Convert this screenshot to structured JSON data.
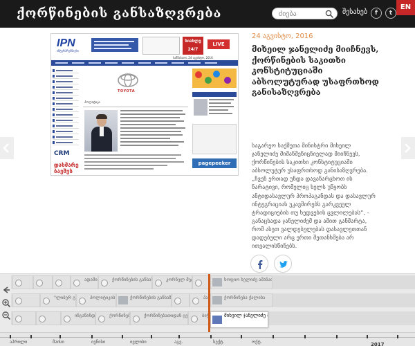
{
  "header": {
    "site_title": "ქორწინების განსაზღვრება",
    "search_placeholder": "ძიება",
    "about_label": "შესახებ",
    "facebook_label": "f",
    "twitter_label": "t",
    "lang_label": "EN"
  },
  "preview": {
    "logo": "IPN",
    "logo_sub": "ინტერპრესნიუსი",
    "ad_badge": "სიახლე 24/7",
    "live_label": "LIVE",
    "date_text": "სამშაბათი, 24 აგვისტო, 2016",
    "brand_text": "TOYOTA",
    "tab_label": "პოლიტიკა",
    "crm_label": "CRM",
    "bottom_logo": "დახმარე ბავშვს",
    "pagepeeker_label": "pagepeeker"
  },
  "article": {
    "date": "24 აგვისტო, 2016",
    "title": "მიხეილ ჯანელიძე მიიჩნევს, ქორწინების საკითხი კონსტიტუციაში აბსოლუტურად უსაფრთხოდ განისაზღვრება",
    "body": "საგარეო საქმეთა მინისტრი მიხეილ ჯანელიძე მიმანშენიცნიელად მიიჩნევს, ქორწინების საკითხი კონსტიტუციაში აბსოლუტურ უსაფრთხოდ განისაზღვრება. „ჩვენ ერთად უნდა დავანარცხოთ ის ნარატივი, რომელიც ხელს უწყობს ანტიდასავლურ პროპაგანდას და დასავლურ ინტეგრაციას უკავშირებს გარკვეულ ტრადიციების თუ ხედვების ცვლილებას“, - განაცხადა ჯანელიძემ და ამით განმარტა, რომ ასეთ ვალდებულებას დასავლეთთან დადებული არც ერთი შეთანხმება არ ითვალისწინებს."
  },
  "share": {
    "facebook_label": "f",
    "twitter_label": "t"
  },
  "timeline": {
    "rows": [
      {
        "items": [
          {
            "label": "",
            "kind": "dot"
          },
          {
            "label": "",
            "kind": "dot"
          },
          {
            "label": "",
            "kind": "dot"
          },
          {
            "label": "ადამიან უფლებები",
            "kind": "dot"
          },
          {
            "label": "ქორწინების განსაზღვრება",
            "kind": "dot"
          },
          {
            "label": "კორნელ მეტრი ნაწილდებულია",
            "kind": "dot"
          },
          {
            "label": "",
            "kind": "dot"
          },
          {
            "label": "სოფიო ხელიძე ამანათ ანგარიშ",
            "kind": "thumb"
          }
        ]
      },
      {
        "items": [
          {
            "label": "",
            "kind": "dot"
          },
          {
            "label": "\"ლიბერ გვინერება\"",
            "kind": "dot"
          },
          {
            "label": "პოლიტიკის ქორწინებაშია",
            "kind": "dot"
          },
          {
            "label": "ქორწინების განსაზღვრება",
            "kind": "dot"
          },
          {
            "label": "",
            "kind": "dot"
          },
          {
            "label": "პაატა ზაქარეიშვილი",
            "kind": "dot"
          },
          {
            "label": "ქორწინება ქალისა",
            "kind": "thumb"
          }
        ]
      },
      {
        "items": [
          {
            "label": "",
            "kind": "dot"
          },
          {
            "label": "",
            "kind": "dot"
          },
          {
            "label": "ინგაწინდუტუ დაიაური",
            "kind": "dot"
          },
          {
            "label": "ქორწინების ცვლილება",
            "kind": "dot"
          },
          {
            "label": "ქორწინებათიდან ცვლილებათიდს",
            "kind": "dot"
          },
          {
            "label": "ბიჭეხაბე ებუაზ",
            "kind": "dot"
          },
          {
            "label": "მიხეილ ჯანელიძე მიმანშენიცნიელად",
            "kind": "thumb",
            "active": true
          }
        ]
      }
    ],
    "months": [
      "აპრილი",
      "მაისი",
      "ივნისი",
      "ივლისი",
      "აგვ.",
      "სექტ.",
      "ოქტ."
    ],
    "year": "2017"
  },
  "colors": {
    "header_bg": "#1a1a1a",
    "accent": "#e08a44",
    "lang_tab": "#c62828",
    "facebook": "#3b5998",
    "twitter": "#1da1f2",
    "timeline_marker": "#d05a1a"
  }
}
